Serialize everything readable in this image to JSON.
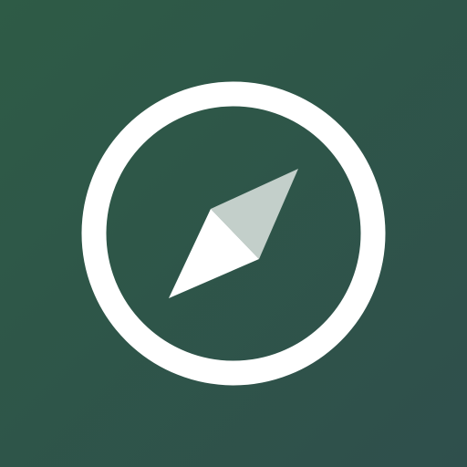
{
  "icon": {
    "name": "compass-icon",
    "colors": {
      "background_start": "#2e5b46",
      "background_end": "#2f4f4c",
      "ring": "#ffffff",
      "needle_light": "#ffffff",
      "needle_muted": "#c3cfca"
    }
  }
}
